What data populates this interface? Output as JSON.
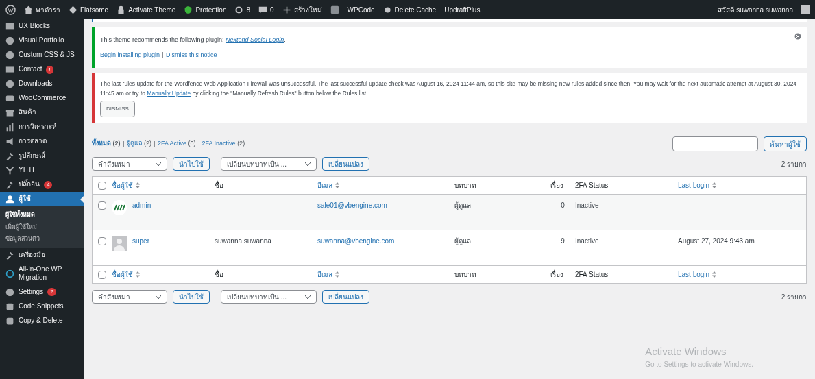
{
  "admin_bar": {
    "site": "พาดำรา",
    "items": [
      {
        "kind": "theme",
        "label": "Flatsome"
      },
      {
        "kind": "lock",
        "label": "Activate Theme"
      },
      {
        "kind": "shield",
        "label": "Protection"
      },
      {
        "kind": "updates",
        "label": "8"
      },
      {
        "kind": "comments",
        "label": "0"
      },
      {
        "kind": "new",
        "label": "สร้างใหม่"
      },
      {
        "kind": "yoast"
      },
      {
        "kind": "plain",
        "label": "WPCode"
      },
      {
        "kind": "cache",
        "label": "Delete Cache"
      },
      {
        "kind": "plain",
        "label": "UpdraftPlus"
      }
    ],
    "greeting": "สวัสดี suwanna suwanna"
  },
  "sidebar": {
    "items": [
      {
        "label": "UX Blocks",
        "selected": false
      },
      {
        "label": "Visual Portfolio",
        "selected": false
      },
      {
        "label": "Custom CSS & JS",
        "selected": false
      },
      {
        "label": "Contact",
        "badge": "!",
        "selected": false
      },
      {
        "label": "Downloads",
        "selected": false
      },
      {
        "label": "WooCommerce",
        "selected": false
      },
      {
        "label": "สินค้า",
        "selected": false
      },
      {
        "label": "การวิเคราะห์",
        "selected": false
      },
      {
        "label": "การตลาด",
        "selected": false
      },
      {
        "label": "รูปลักษณ์",
        "selected": false
      },
      {
        "label": "YITH",
        "selected": false
      },
      {
        "label": "ปลั๊กอิน",
        "badge": "4",
        "selected": false
      },
      {
        "label": "ผู้ใช้",
        "selected": true,
        "children": [
          {
            "label": "ผู้ใช้ทั้งหมด",
            "selected": true
          },
          {
            "label": "เพิ่มผู้ใช้ใหม่",
            "selected": false
          },
          {
            "label": "ข้อมูลส่วนตัว",
            "selected": false
          }
        ]
      },
      {
        "label": "เครื่องมือ",
        "selected": false
      },
      {
        "label": "All-in-One WP Migration",
        "selected": false
      },
      {
        "label": "Settings",
        "badge": "2",
        "selected": false
      },
      {
        "label": "Code Snippets",
        "selected": false
      },
      {
        "label": "Copy & Delete",
        "selected": false
      }
    ]
  },
  "notices": [
    {
      "kind": "success",
      "text": "This theme recommends the following plugin: ",
      "link": "Nextend Social Login",
      "tail": ".",
      "actions": [
        "Begin installing plugin",
        "Dismiss this notice"
      ],
      "dismissible": true
    },
    {
      "kind": "error",
      "text_before": "The last rules update for the Wordfence Web Application Firewall was unsuccessful. The last successful update check was August 16, 2024 11:44 am, so this site may be missing new rules added since then. You may wait for the next automatic attempt at August 30, 2024 11:45 am or try to ",
      "link": "Manually Update",
      "text_after": " by clicking the \"Manually Refresh Rules\" button below the Rules list.",
      "button": "DISMISS"
    }
  ],
  "filters": [
    {
      "label": "ทั้งหมด",
      "count": "(2)",
      "selected": true
    },
    {
      "label": "ผู้ดูแล",
      "count": "(2)",
      "selected": false
    },
    {
      "label": "2FA Active",
      "count": "(0)",
      "selected": false
    },
    {
      "label": "2FA Inactive",
      "count": "(2)",
      "selected": false
    }
  ],
  "search": {
    "button": "ค้นหาผู้ใช้"
  },
  "bulk_top": {
    "action": "คำสั่งเหมา",
    "apply": "นำไปใช้",
    "role": "เปลี่ยนบทบาทเป็น ...",
    "change": "เปลี่ยนแปลง",
    "count": "2 รายกา"
  },
  "table_header": {
    "checked": false,
    "columns": [
      {
        "label": "ชื่อผู้ใช้",
        "sortable": true,
        "link": true
      },
      {
        "label": "ชื่อ",
        "sortable": false,
        "link": false
      },
      {
        "label": "อีเมล",
        "sortable": true,
        "link": true
      },
      {
        "label": "บทบาท",
        "sortable": false,
        "link": false
      },
      {
        "label": "เรื่อง",
        "sortable": false,
        "link": false
      },
      {
        "label": "2FA Status",
        "sortable": false,
        "link": false
      },
      {
        "label": "Last Login",
        "sortable": true,
        "link": true
      }
    ]
  },
  "rows": [
    {
      "kind": "logo",
      "username": "admin",
      "name": "—",
      "email": "sale01@vbengine.com",
      "role": "ผู้ดูแล",
      "posts": "0",
      "status": "Inactive",
      "last_login": "-",
      "checked": false
    },
    {
      "kind": "silhouette",
      "username": "super",
      "name": "suwanna suwanna",
      "email": "suwanna@vbengine.com",
      "role": "ผู้ดูแล",
      "posts": "9",
      "status": "Inactive",
      "last_login": "August 27, 2024 9:43 am",
      "checked": false
    }
  ],
  "table_footer": {
    "checked": false,
    "columns": [
      {
        "label": "ชื่อผู้ใช้",
        "sortable": true,
        "link": true
      },
      {
        "label": "ชื่อ",
        "sortable": false,
        "link": false
      },
      {
        "label": "อีเมล",
        "sortable": true,
        "link": true
      },
      {
        "label": "บทบาท",
        "sortable": false,
        "link": false
      },
      {
        "label": "เรื่อง",
        "sortable": false,
        "link": false
      },
      {
        "label": "2FA Status",
        "sortable": false,
        "link": false
      },
      {
        "label": "Last Login",
        "sortable": true,
        "link": true
      }
    ]
  },
  "bulk_bottom": {
    "action": "คำสั่งเหมา",
    "apply": "นำไปใช้",
    "role": "เปลี่ยนบทบาทเป็น ...",
    "change": "เปลี่ยนแปลง",
    "count": "2 รายกา"
  },
  "os_overlay": {
    "title": "Activate Windows",
    "subtitle": "Go to Settings to activate Windows."
  }
}
